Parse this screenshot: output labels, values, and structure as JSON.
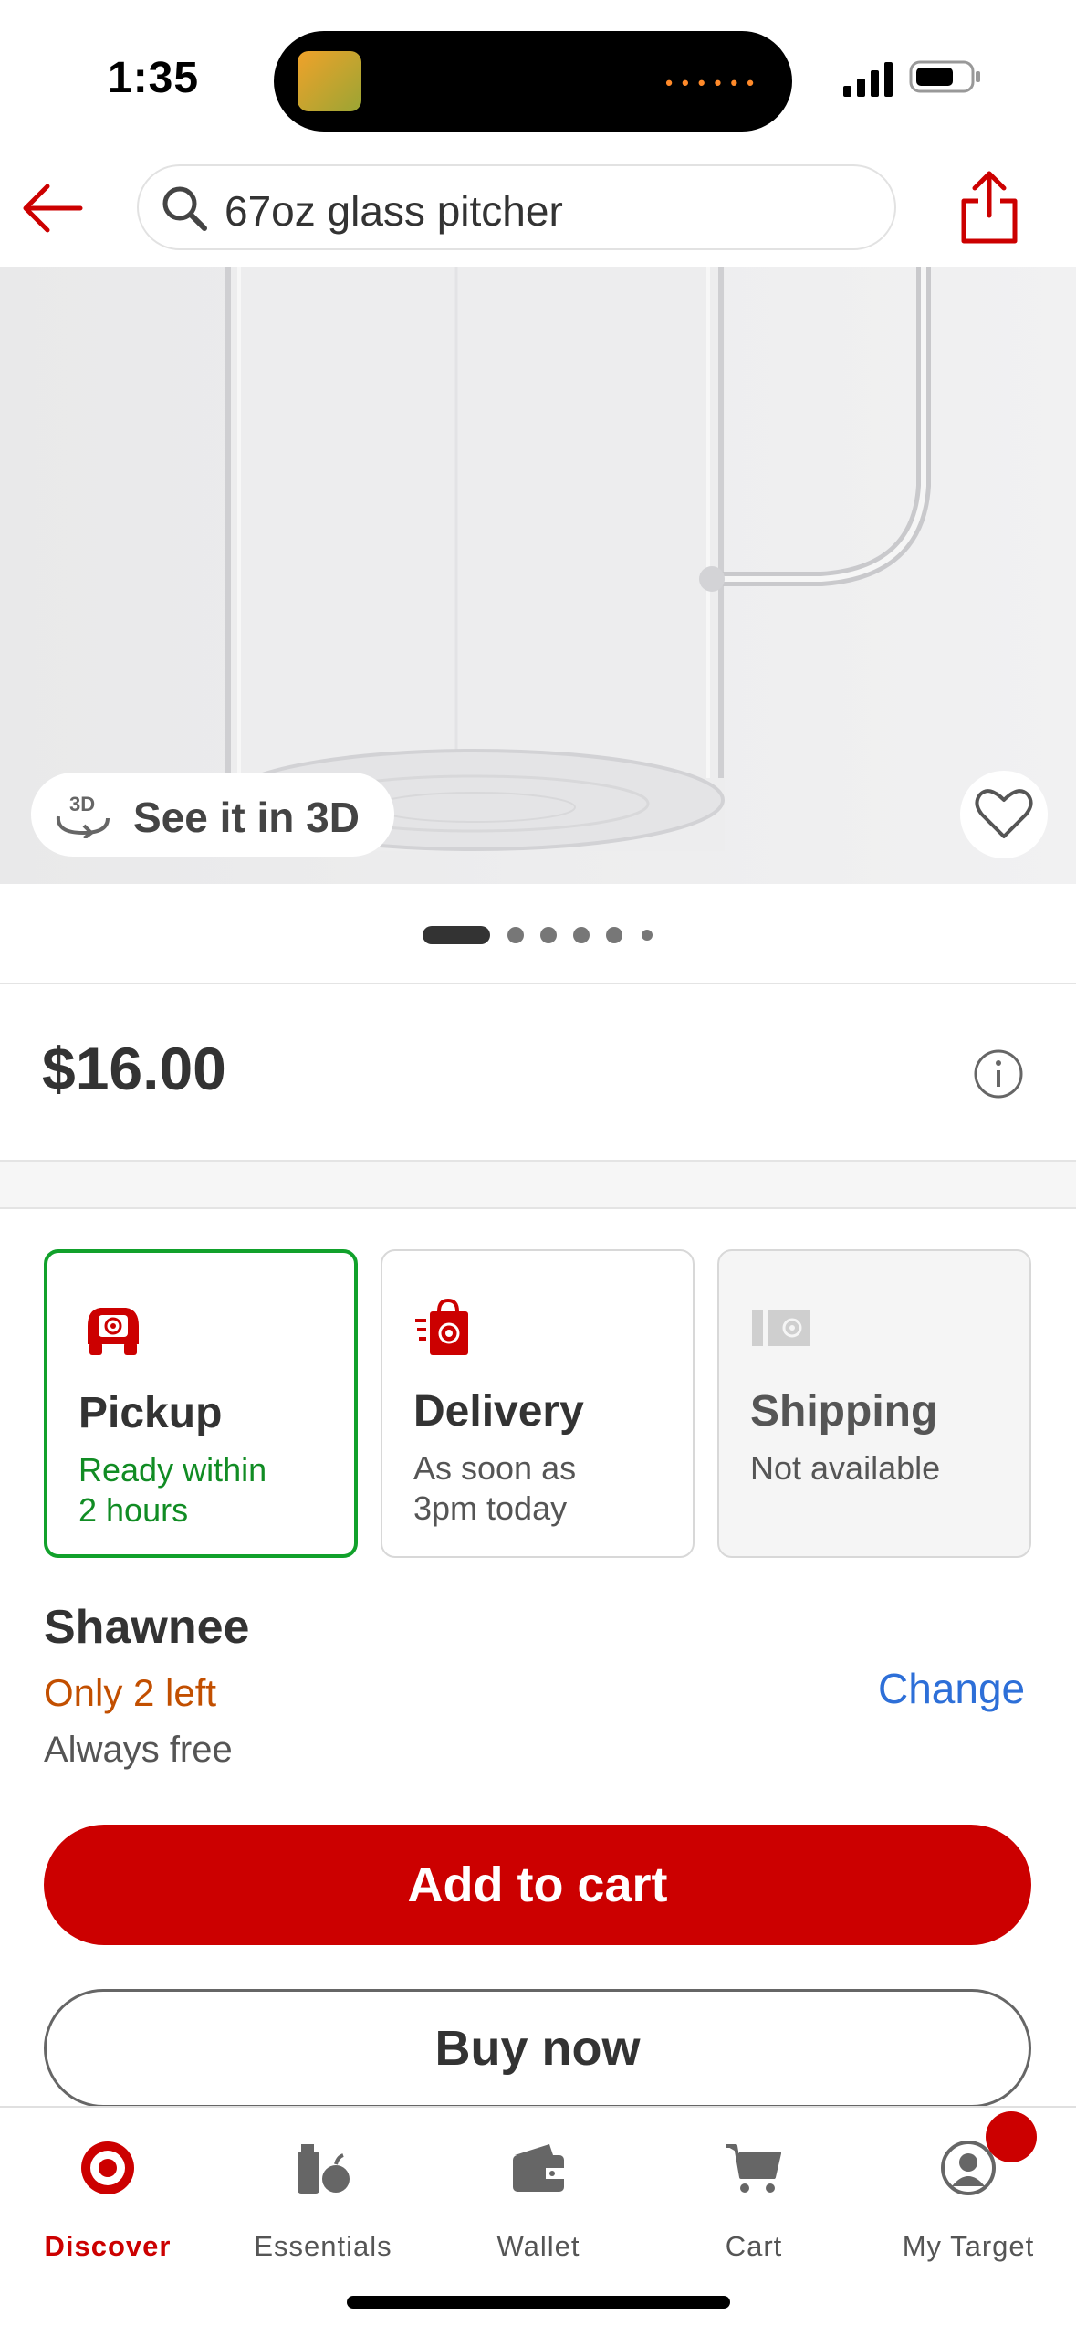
{
  "status_bar": {
    "time": "1:35"
  },
  "search": {
    "query": "67oz glass pitcher"
  },
  "image": {
    "see_3d_label": "See it in 3D",
    "carousel_total": 6,
    "carousel_active": 1
  },
  "price": {
    "value": "$16.00"
  },
  "fulfillment": [
    {
      "title": "Pickup",
      "subtitle": "Ready within\n2 hours",
      "selected": true
    },
    {
      "title": "Delivery",
      "subtitle": "As soon as\n3pm today",
      "selected": false
    },
    {
      "title": "Shipping",
      "subtitle": "Not available",
      "selected": false
    }
  ],
  "store": {
    "name": "Shawnee",
    "stock": "Only 2 left",
    "cost": "Always free",
    "change_label": "Change"
  },
  "actions": {
    "add_to_cart": "Add to cart",
    "buy_now": "Buy now"
  },
  "nav": {
    "items": [
      {
        "label": "Discover",
        "icon": "target-bullseye-icon",
        "active": true
      },
      {
        "label": "Essentials",
        "icon": "essentials-icon",
        "active": false
      },
      {
        "label": "Wallet",
        "icon": "wallet-icon",
        "active": false
      },
      {
        "label": "Cart",
        "icon": "cart-icon",
        "active": false
      },
      {
        "label": "My Target",
        "icon": "profile-icon",
        "active": false
      }
    ],
    "notification_badge": true
  },
  "colors": {
    "brand_red": "#cc0000",
    "pickup_green": "#11a12b",
    "stock_orange": "#c24f00",
    "link_blue": "#2d6fd8"
  }
}
